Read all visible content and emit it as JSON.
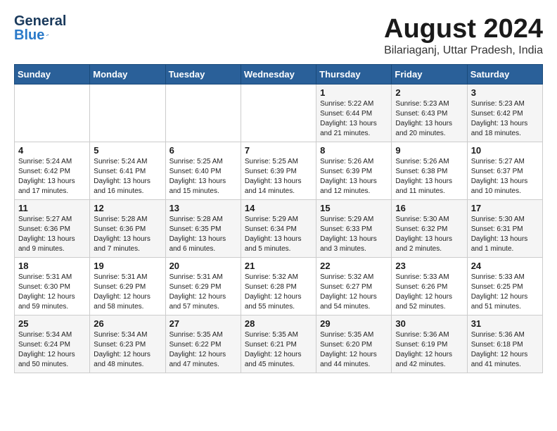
{
  "header": {
    "logo_line1": "General",
    "logo_line2": "Blue",
    "month_year": "August 2024",
    "location": "Bilariaganj, Uttar Pradesh, India"
  },
  "weekdays": [
    "Sunday",
    "Monday",
    "Tuesday",
    "Wednesday",
    "Thursday",
    "Friday",
    "Saturday"
  ],
  "weeks": [
    [
      {
        "day": "",
        "info": ""
      },
      {
        "day": "",
        "info": ""
      },
      {
        "day": "",
        "info": ""
      },
      {
        "day": "",
        "info": ""
      },
      {
        "day": "1",
        "info": "Sunrise: 5:22 AM\nSunset: 6:44 PM\nDaylight: 13 hours\nand 21 minutes."
      },
      {
        "day": "2",
        "info": "Sunrise: 5:23 AM\nSunset: 6:43 PM\nDaylight: 13 hours\nand 20 minutes."
      },
      {
        "day": "3",
        "info": "Sunrise: 5:23 AM\nSunset: 6:42 PM\nDaylight: 13 hours\nand 18 minutes."
      }
    ],
    [
      {
        "day": "4",
        "info": "Sunrise: 5:24 AM\nSunset: 6:42 PM\nDaylight: 13 hours\nand 17 minutes."
      },
      {
        "day": "5",
        "info": "Sunrise: 5:24 AM\nSunset: 6:41 PM\nDaylight: 13 hours\nand 16 minutes."
      },
      {
        "day": "6",
        "info": "Sunrise: 5:25 AM\nSunset: 6:40 PM\nDaylight: 13 hours\nand 15 minutes."
      },
      {
        "day": "7",
        "info": "Sunrise: 5:25 AM\nSunset: 6:39 PM\nDaylight: 13 hours\nand 14 minutes."
      },
      {
        "day": "8",
        "info": "Sunrise: 5:26 AM\nSunset: 6:39 PM\nDaylight: 13 hours\nand 12 minutes."
      },
      {
        "day": "9",
        "info": "Sunrise: 5:26 AM\nSunset: 6:38 PM\nDaylight: 13 hours\nand 11 minutes."
      },
      {
        "day": "10",
        "info": "Sunrise: 5:27 AM\nSunset: 6:37 PM\nDaylight: 13 hours\nand 10 minutes."
      }
    ],
    [
      {
        "day": "11",
        "info": "Sunrise: 5:27 AM\nSunset: 6:36 PM\nDaylight: 13 hours\nand 9 minutes."
      },
      {
        "day": "12",
        "info": "Sunrise: 5:28 AM\nSunset: 6:36 PM\nDaylight: 13 hours\nand 7 minutes."
      },
      {
        "day": "13",
        "info": "Sunrise: 5:28 AM\nSunset: 6:35 PM\nDaylight: 13 hours\nand 6 minutes."
      },
      {
        "day": "14",
        "info": "Sunrise: 5:29 AM\nSunset: 6:34 PM\nDaylight: 13 hours\nand 5 minutes."
      },
      {
        "day": "15",
        "info": "Sunrise: 5:29 AM\nSunset: 6:33 PM\nDaylight: 13 hours\nand 3 minutes."
      },
      {
        "day": "16",
        "info": "Sunrise: 5:30 AM\nSunset: 6:32 PM\nDaylight: 13 hours\nand 2 minutes."
      },
      {
        "day": "17",
        "info": "Sunrise: 5:30 AM\nSunset: 6:31 PM\nDaylight: 13 hours\nand 1 minute."
      }
    ],
    [
      {
        "day": "18",
        "info": "Sunrise: 5:31 AM\nSunset: 6:30 PM\nDaylight: 12 hours\nand 59 minutes."
      },
      {
        "day": "19",
        "info": "Sunrise: 5:31 AM\nSunset: 6:29 PM\nDaylight: 12 hours\nand 58 minutes."
      },
      {
        "day": "20",
        "info": "Sunrise: 5:31 AM\nSunset: 6:29 PM\nDaylight: 12 hours\nand 57 minutes."
      },
      {
        "day": "21",
        "info": "Sunrise: 5:32 AM\nSunset: 6:28 PM\nDaylight: 12 hours\nand 55 minutes."
      },
      {
        "day": "22",
        "info": "Sunrise: 5:32 AM\nSunset: 6:27 PM\nDaylight: 12 hours\nand 54 minutes."
      },
      {
        "day": "23",
        "info": "Sunrise: 5:33 AM\nSunset: 6:26 PM\nDaylight: 12 hours\nand 52 minutes."
      },
      {
        "day": "24",
        "info": "Sunrise: 5:33 AM\nSunset: 6:25 PM\nDaylight: 12 hours\nand 51 minutes."
      }
    ],
    [
      {
        "day": "25",
        "info": "Sunrise: 5:34 AM\nSunset: 6:24 PM\nDaylight: 12 hours\nand 50 minutes."
      },
      {
        "day": "26",
        "info": "Sunrise: 5:34 AM\nSunset: 6:23 PM\nDaylight: 12 hours\nand 48 minutes."
      },
      {
        "day": "27",
        "info": "Sunrise: 5:35 AM\nSunset: 6:22 PM\nDaylight: 12 hours\nand 47 minutes."
      },
      {
        "day": "28",
        "info": "Sunrise: 5:35 AM\nSunset: 6:21 PM\nDaylight: 12 hours\nand 45 minutes."
      },
      {
        "day": "29",
        "info": "Sunrise: 5:35 AM\nSunset: 6:20 PM\nDaylight: 12 hours\nand 44 minutes."
      },
      {
        "day": "30",
        "info": "Sunrise: 5:36 AM\nSunset: 6:19 PM\nDaylight: 12 hours\nand 42 minutes."
      },
      {
        "day": "31",
        "info": "Sunrise: 5:36 AM\nSunset: 6:18 PM\nDaylight: 12 hours\nand 41 minutes."
      }
    ]
  ]
}
